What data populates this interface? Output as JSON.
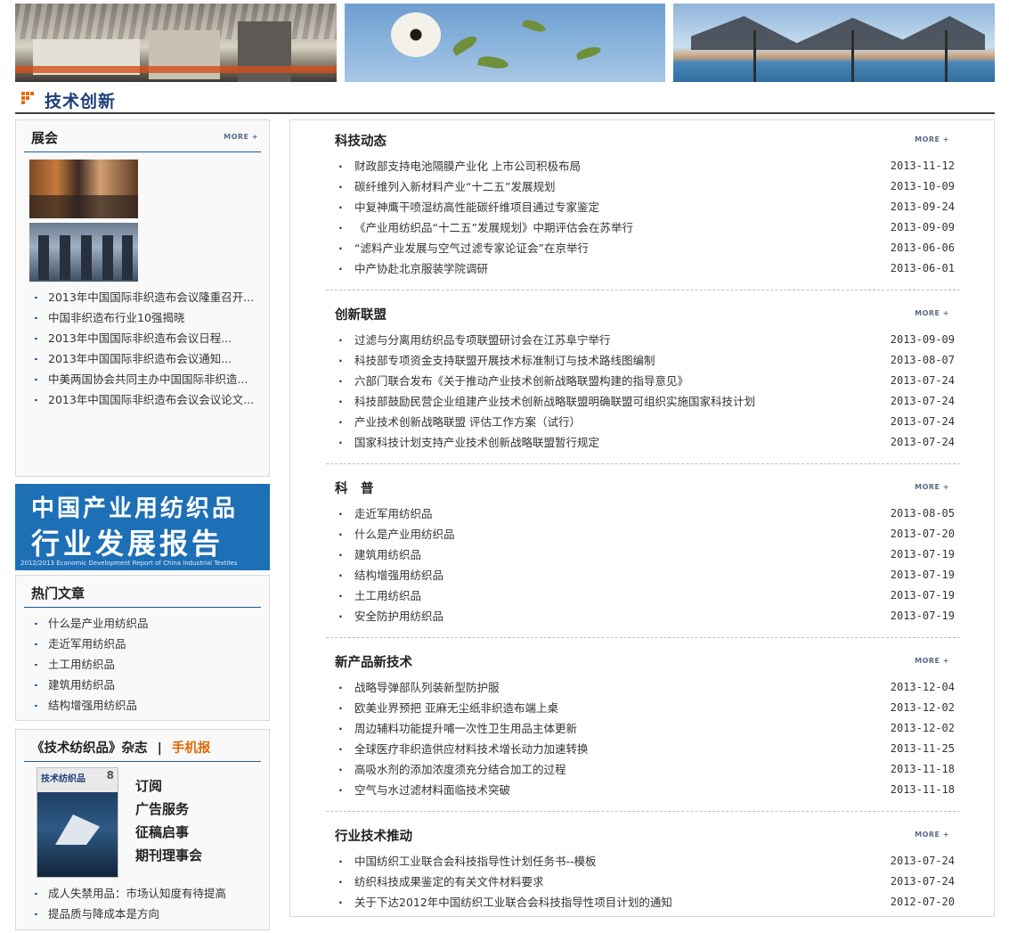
{
  "section": {
    "title": "技术创新"
  },
  "more_label": "MORE +",
  "exhibition": {
    "title": "展会",
    "items": [
      "2013年中国国际非织造布会议隆重召开...",
      "中国非织造布行业10强揭晓",
      "2013年中国国际非织造布会议日程...",
      "2013年中国国际非织造布会议通知...",
      "中美两国协会共同主办中国国际非织造...",
      "2013年中国国际非织造布会议会议论文..."
    ]
  },
  "ad": {
    "line1": "中国产业用纺织品",
    "line2": "行业发展报告",
    "line3": "2012/2013 Economic Development Report of China Industrial Textiles"
  },
  "hot": {
    "title": "热门文章",
    "items": [
      "什么是产业用纺织品",
      "走近军用纺织品",
      "土工用纺织品",
      "建筑用纺织品",
      "结构增强用纺织品"
    ]
  },
  "magazine": {
    "title_prefix": "《技术纺织品》杂志",
    "separator": "|",
    "mobile": "手机报",
    "cover_title": "技术纺织品",
    "cover_number": "8",
    "links": [
      "订阅",
      "广告服务",
      "征稿启事",
      "期刊理事会"
    ],
    "items": [
      "成人失禁用品：市场认知度有待提高",
      "提品质与降成本是方向"
    ]
  },
  "main_sections": [
    {
      "title": "科技动态",
      "items": [
        {
          "text": "财政部支持电池隔膜产业化 上市公司积极布局",
          "date": "2013-11-12"
        },
        {
          "text": "碳纤维列入新材料产业“十二五”发展规划",
          "date": "2013-10-09"
        },
        {
          "text": "中复神鹰干喷湿纺高性能碳纤维项目通过专家鉴定",
          "date": "2013-09-24"
        },
        {
          "text": "《产业用纺织品“十二五”发展规划》中期评估会在苏举行",
          "date": "2013-09-09"
        },
        {
          "text": "“滤料产业发展与空气过滤专家论证会”在京举行",
          "date": "2013-06-06"
        },
        {
          "text": "中产协赴北京服装学院调研",
          "date": "2013-06-01"
        }
      ]
    },
    {
      "title": "创新联盟",
      "items": [
        {
          "text": "过滤与分离用纺织品专项联盟研讨会在江苏阜宁举行",
          "date": "2013-09-09"
        },
        {
          "text": "科技部专项资金支持联盟开展技术标准制订与技术路线图编制",
          "date": "2013-08-07"
        },
        {
          "text": "六部门联合发布《关于推动产业技术创新战略联盟构建的指导意见》",
          "date": "2013-07-24"
        },
        {
          "text": "科技部鼓励民营企业组建产业技术创新战略联盟明确联盟可组织实施国家科技计划",
          "date": "2013-07-24"
        },
        {
          "text": "产业技术创新战略联盟 评估工作方案（试行）",
          "date": "2013-07-24"
        },
        {
          "text": "国家科技计划支持产业技术创新战略联盟暂行规定",
          "date": "2013-07-24"
        }
      ]
    },
    {
      "title": "科　普",
      "items": [
        {
          "text": "走近军用纺织品",
          "date": "2013-08-05"
        },
        {
          "text": "什么是产业用纺织品",
          "date": "2013-07-20"
        },
        {
          "text": "建筑用纺织品",
          "date": "2013-07-19"
        },
        {
          "text": "结构增强用纺织品",
          "date": "2013-07-19"
        },
        {
          "text": "土工用纺织品",
          "date": "2013-07-19"
        },
        {
          "text": "安全防护用纺织品",
          "date": "2013-07-19"
        }
      ]
    },
    {
      "title": "新产品新技术",
      "items": [
        {
          "text": "战略导弹部队列装新型防护服",
          "date": "2013-12-04"
        },
        {
          "text": "欧美业界预把 亚麻无尘纸非织造布端上桌",
          "date": "2013-12-02"
        },
        {
          "text": "周边辅料功能提升哺一次性卫生用品主体更新",
          "date": "2013-12-02"
        },
        {
          "text": "全球医疗非织造供应材料技术增长动力加速转换",
          "date": "2013-11-25"
        },
        {
          "text": "高吸水剂的添加浓度须充分结合加工的过程",
          "date": "2013-11-18"
        },
        {
          "text": "空气与水过滤材料面临技术突破",
          "date": "2013-11-18"
        }
      ]
    },
    {
      "title": "行业技术推动",
      "items": [
        {
          "text": "中国纺织工业联合会科技指导性计划任务书--模板",
          "date": "2013-07-24"
        },
        {
          "text": "纺织科技成果鉴定的有关文件材料要求",
          "date": "2013-07-24"
        },
        {
          "text": "关于下达2012年中国纺织工业联合会科技指导性项目计划的通知",
          "date": "2012-07-20"
        }
      ]
    }
  ]
}
